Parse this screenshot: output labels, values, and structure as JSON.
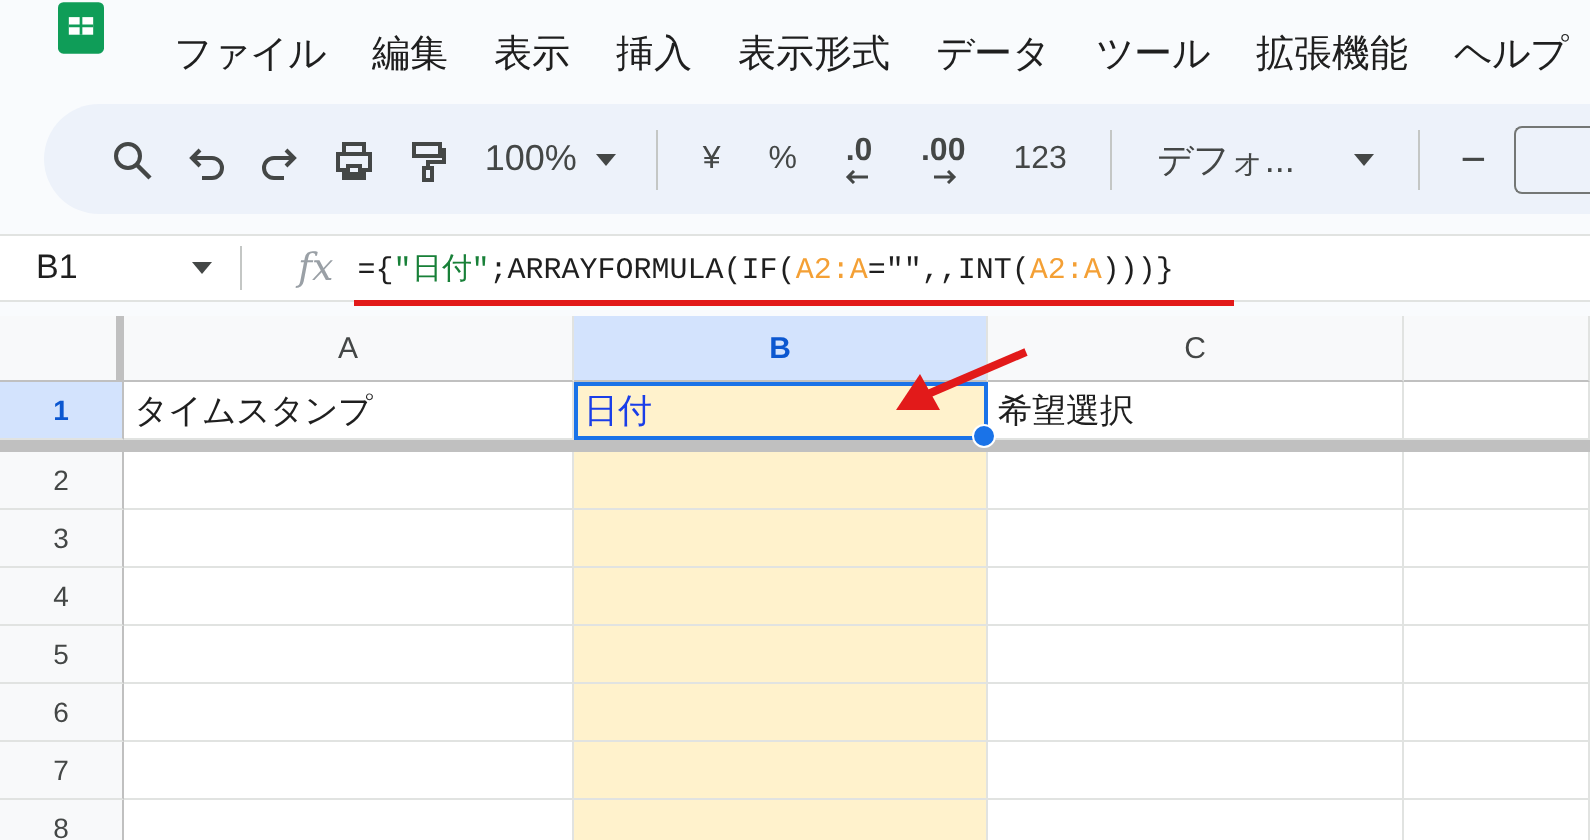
{
  "menu": [
    "ファイル",
    "編集",
    "表示",
    "挿入",
    "表示形式",
    "データ",
    "ツール",
    "拡張機能",
    "ヘルプ"
  ],
  "toolbar": {
    "zoom": "100%",
    "format_buttons": [
      {
        "text": "¥",
        "kind": "plain"
      },
      {
        "text": "%",
        "kind": "plain"
      },
      {
        "text": ".0",
        "kind": "decrease"
      },
      {
        "text": ".00",
        "kind": "increase"
      },
      {
        "text": "123",
        "kind": "plain"
      }
    ],
    "font": "デフォ...",
    "minus": "−"
  },
  "formula_bar": {
    "cell_ref": "B1",
    "fx": "fx",
    "formula": [
      {
        "text": "={",
        "kind": "plain"
      },
      {
        "text": "\"日付\"",
        "kind": "string"
      },
      {
        "text": ";ARRAYFORMULA(IF(",
        "kind": "plain"
      },
      {
        "text": "A2:A",
        "kind": "range"
      },
      {
        "text": "=\"\",,INT(",
        "kind": "plain"
      },
      {
        "text": "A2:A",
        "kind": "range"
      },
      {
        "text": ")))}",
        "kind": "plain"
      }
    ]
  },
  "columns": [
    {
      "label": "A",
      "selected": false
    },
    {
      "label": "B",
      "selected": true
    },
    {
      "label": "C",
      "selected": false
    }
  ],
  "rows": [
    {
      "number": "1",
      "selected": true,
      "frozen": true,
      "cells": [
        {
          "text": "タイムスタンプ",
          "selected": false
        },
        {
          "text": "日付",
          "selected": true
        },
        {
          "text": "希望選択",
          "selected": false
        }
      ]
    },
    {
      "number": "2",
      "selected": false,
      "frozen": false,
      "cells": []
    },
    {
      "number": "3",
      "selected": false,
      "frozen": false,
      "cells": []
    },
    {
      "number": "4",
      "selected": false,
      "frozen": false,
      "cells": []
    },
    {
      "number": "5",
      "selected": false,
      "frozen": false,
      "cells": []
    },
    {
      "number": "6",
      "selected": false,
      "frozen": false,
      "cells": []
    },
    {
      "number": "7",
      "selected": false,
      "frozen": false,
      "cells": []
    },
    {
      "number": "8",
      "selected": false,
      "frozen": false,
      "cells": []
    }
  ]
}
